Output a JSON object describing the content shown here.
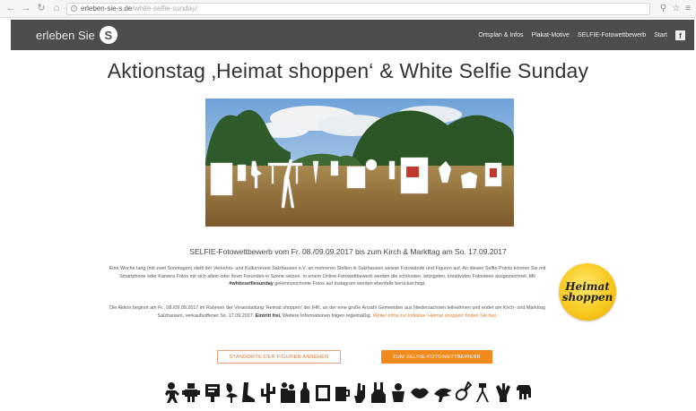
{
  "browser": {
    "back": "←",
    "forward": "→",
    "reload": "↻",
    "home": "⌂",
    "url_domain": "erleben-sie-s.de",
    "url_path": "/white-selfie-sunday/"
  },
  "header": {
    "logo_text": "erleben Sie",
    "logo_mark": "S",
    "nav": [
      "Ortsplan & Infos",
      "Plakat-Motive",
      "SELFIE-Fotowettbewerb",
      "Start"
    ],
    "facebook_glyph": "f"
  },
  "page": {
    "title": "Aktionstag ‚Heimat shoppen‘ & White Selfie Sunday",
    "subheading": "SELFIE-Fotowettbewerb vom Fr. 08./09.09.2017 bis zum Kirch & Markttag am So. 17.09.2017",
    "para1_a": "Eine Woche lang (mit zwei Sonntagen) stellt der Verkehrs- und Kulturverein Salzhausen e.V. an mehreren Stellen in Salzhausen weisse Fotowände und Figuren auf. An diesen Selfie-Points können Sie mit Smartphone oder Kamera Fotos mit sich allein oder Ihren Freunden in Szene setzen. In einem Online-Fotowettbewerb werden die schönsten, witzigsten, kreativsten Fotoideen ausgezeichnet. Mit",
    "para1_hashtag": "#whiteselfiesunday",
    "para1_b": "gekennzeichnete Fotos auf Instagram werden ebenfalls berücksichtigt.",
    "para2_a": "Die Aktion beginnt am Fr., 08./09.09.2017 im Rahmen der Veranstaltung 'Heimat shoppen' der IHK, an der eine große Anzahl Gemeinden aus Niedersachsen teilnehmen und endet am Kirch- und Markttag Salzhausen, verkaufsoffener So. 17.09.2017.",
    "para2_bold": "Eintritt frei.",
    "para2_b": "Weitere Informationen folgen regelmäßig.",
    "para2_link": "Weiter Infos zur Initiative 'Heimat shoppen' finden Sie hier."
  },
  "badge": {
    "line1": "Heimat",
    "line2": "shoppen"
  },
  "buttons": {
    "locations": "STANDORTE DER FIGUREN ANSEHEN",
    "contest": "ZUM SELFIE-FOTOWETTBEWERB"
  },
  "colors": {
    "header_bg": "#4d4d4d",
    "accent": "#f18a1d",
    "badge_yellow": "#f7c71b"
  },
  "pictograms": [
    "gingerbread-man-icon",
    "robot-icon",
    "sign-icon",
    "flamingo-icon",
    "boot-icon",
    "cactus-icon",
    "figures-icon",
    "bottle-icon",
    "frame-icon",
    "mug-icon",
    "hand-icon",
    "rabbit-icon",
    "squirrel-icon",
    "lips-icon",
    "crocodile-icon",
    "guitar-icon",
    "tripod-icon",
    "hand-wave-icon",
    "elephant-icon"
  ]
}
